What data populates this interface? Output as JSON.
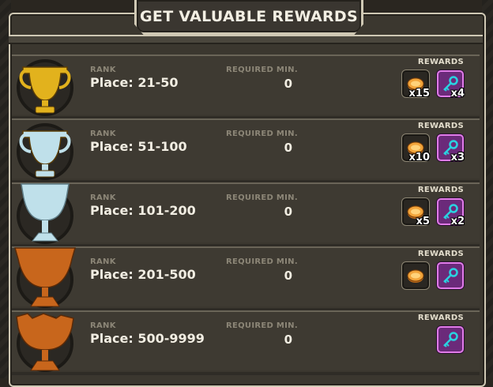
{
  "title": "GET VALUABLE REWARDS",
  "labels": {
    "rank": "RANK",
    "required": "REQUIRED MIN.",
    "rewards": "REWARDS"
  },
  "tiers": [
    {
      "trophy": "gold-trophy",
      "place": "Place: 21-50",
      "required": "0",
      "rewards": [
        {
          "icon": "coin-icon",
          "qty": "x15"
        },
        {
          "icon": "key-icon",
          "qty": "x4"
        }
      ]
    },
    {
      "trophy": "silver-trophy",
      "place": "Place: 51-100",
      "required": "0",
      "rewards": [
        {
          "icon": "coin-icon",
          "qty": "x10"
        },
        {
          "icon": "key-icon",
          "qty": "x3"
        }
      ]
    },
    {
      "trophy": "silver-cup",
      "place": "Place: 101-200",
      "required": "0",
      "rewards": [
        {
          "icon": "coin-icon",
          "qty": "x5"
        },
        {
          "icon": "key-icon",
          "qty": "x2"
        }
      ]
    },
    {
      "trophy": "bronze-cup",
      "place": "Place: 201-500",
      "required": "0",
      "rewards": [
        {
          "icon": "coin-icon",
          "qty": ""
        },
        {
          "icon": "key-icon",
          "qty": ""
        }
      ]
    },
    {
      "trophy": "bronze-bowl",
      "place": "Place: 500-9999",
      "required": "0",
      "rewards": [
        {
          "icon": "key-icon",
          "qty": ""
        }
      ]
    }
  ],
  "colors": {
    "gold": "#e2b21d",
    "silver": "#bfe0ea",
    "bronze": "#c8661c",
    "coin": "#f2a43a",
    "key": "#2ad1e0"
  }
}
